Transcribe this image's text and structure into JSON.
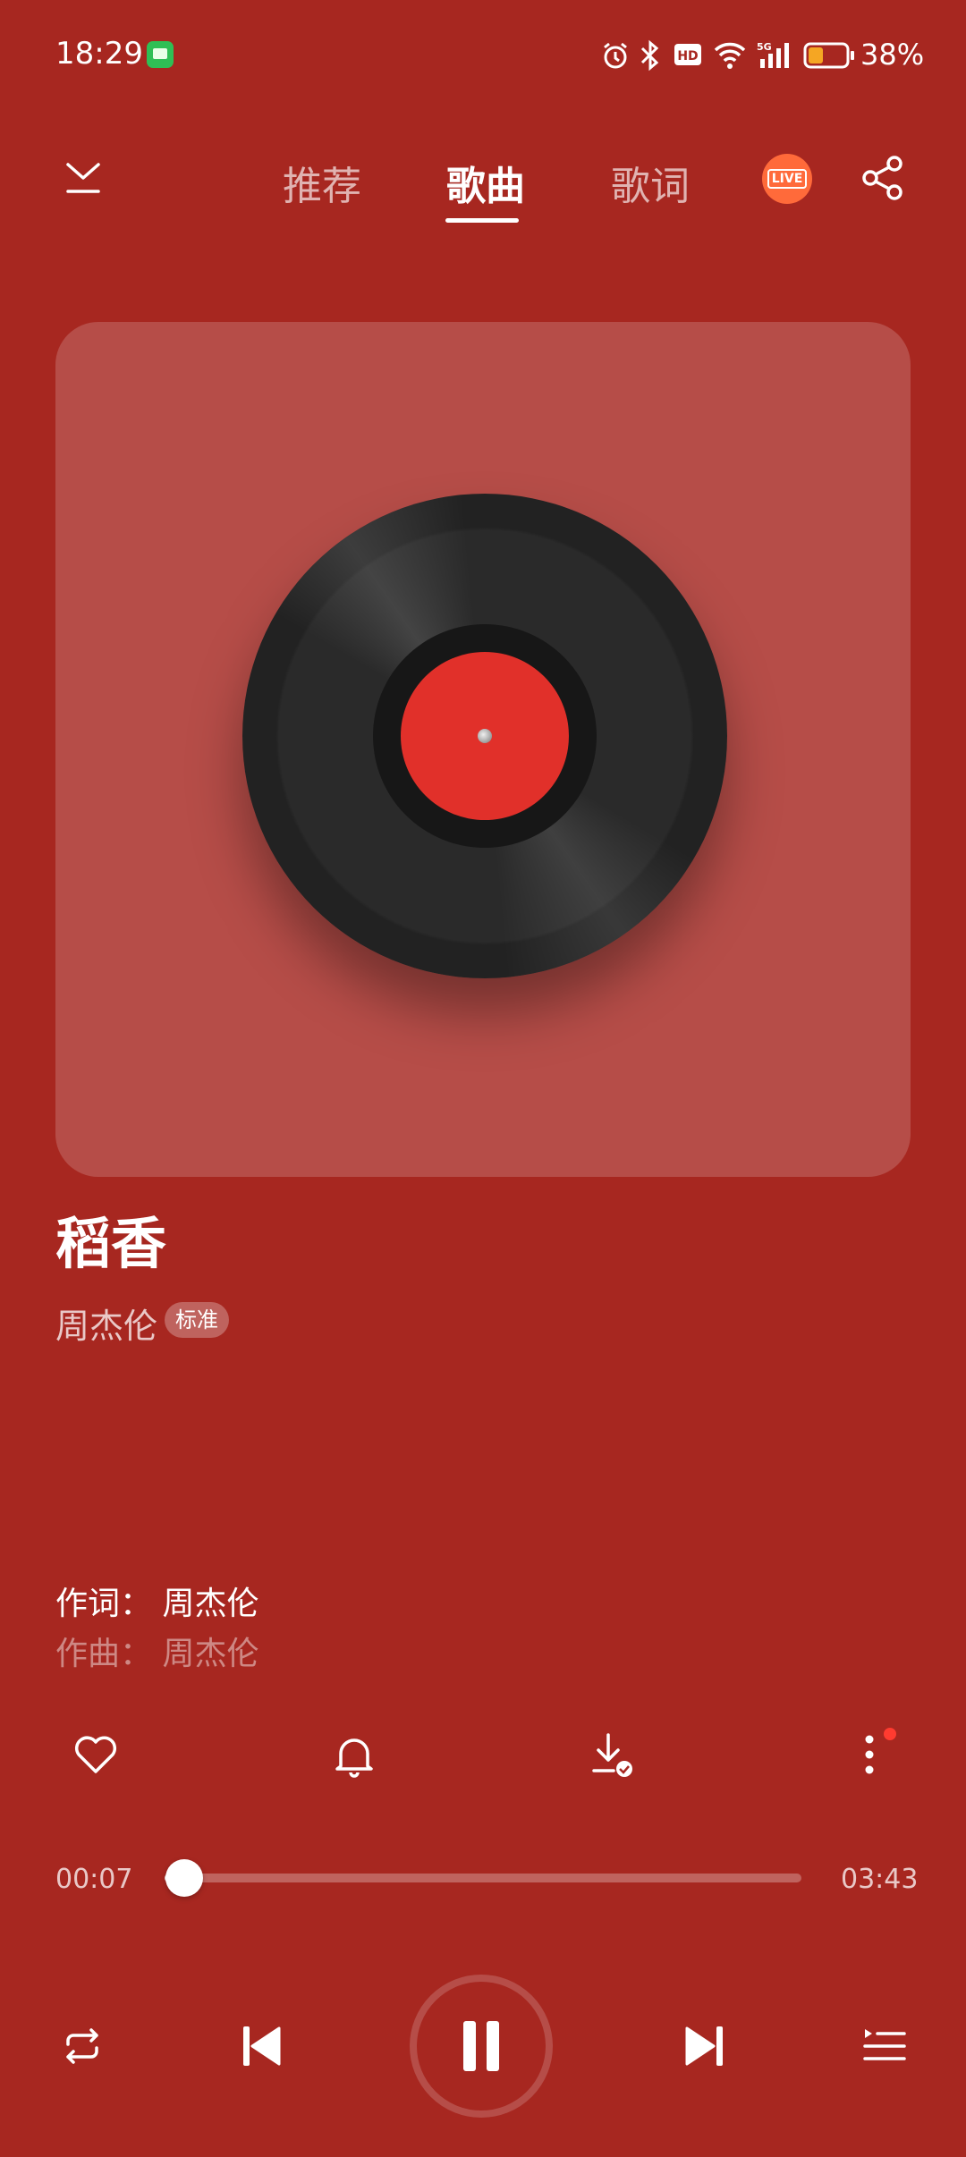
{
  "status_bar": {
    "time": "18:29",
    "battery": "38%",
    "network": "5G"
  },
  "nav": {
    "tabs": [
      {
        "label": "推荐",
        "active": false
      },
      {
        "label": "歌曲",
        "active": true
      },
      {
        "label": "歌词",
        "active": false
      }
    ],
    "live_label": "LIVE"
  },
  "song": {
    "title": "稻香",
    "artist": "周杰伦",
    "quality": "标准"
  },
  "credits": {
    "lyricist": "作词： 周杰伦",
    "composer": "作曲： 周杰伦"
  },
  "progress": {
    "elapsed": "00:07",
    "total": "03:43",
    "fraction": 0.031
  },
  "colors": {
    "background": "#a72720",
    "record_label": "#e1302a",
    "notification_dot": "#ff3b30"
  },
  "icons": {
    "collapse": "chevron-down-icon",
    "share": "share-icon",
    "like": "heart-icon",
    "ringtone": "bell-icon",
    "download": "download-icon",
    "more": "more-vertical-icon",
    "repeat": "repeat-icon",
    "prev": "skip-previous-icon",
    "pause": "pause-icon",
    "next": "skip-next-icon",
    "playlist": "playlist-icon"
  }
}
